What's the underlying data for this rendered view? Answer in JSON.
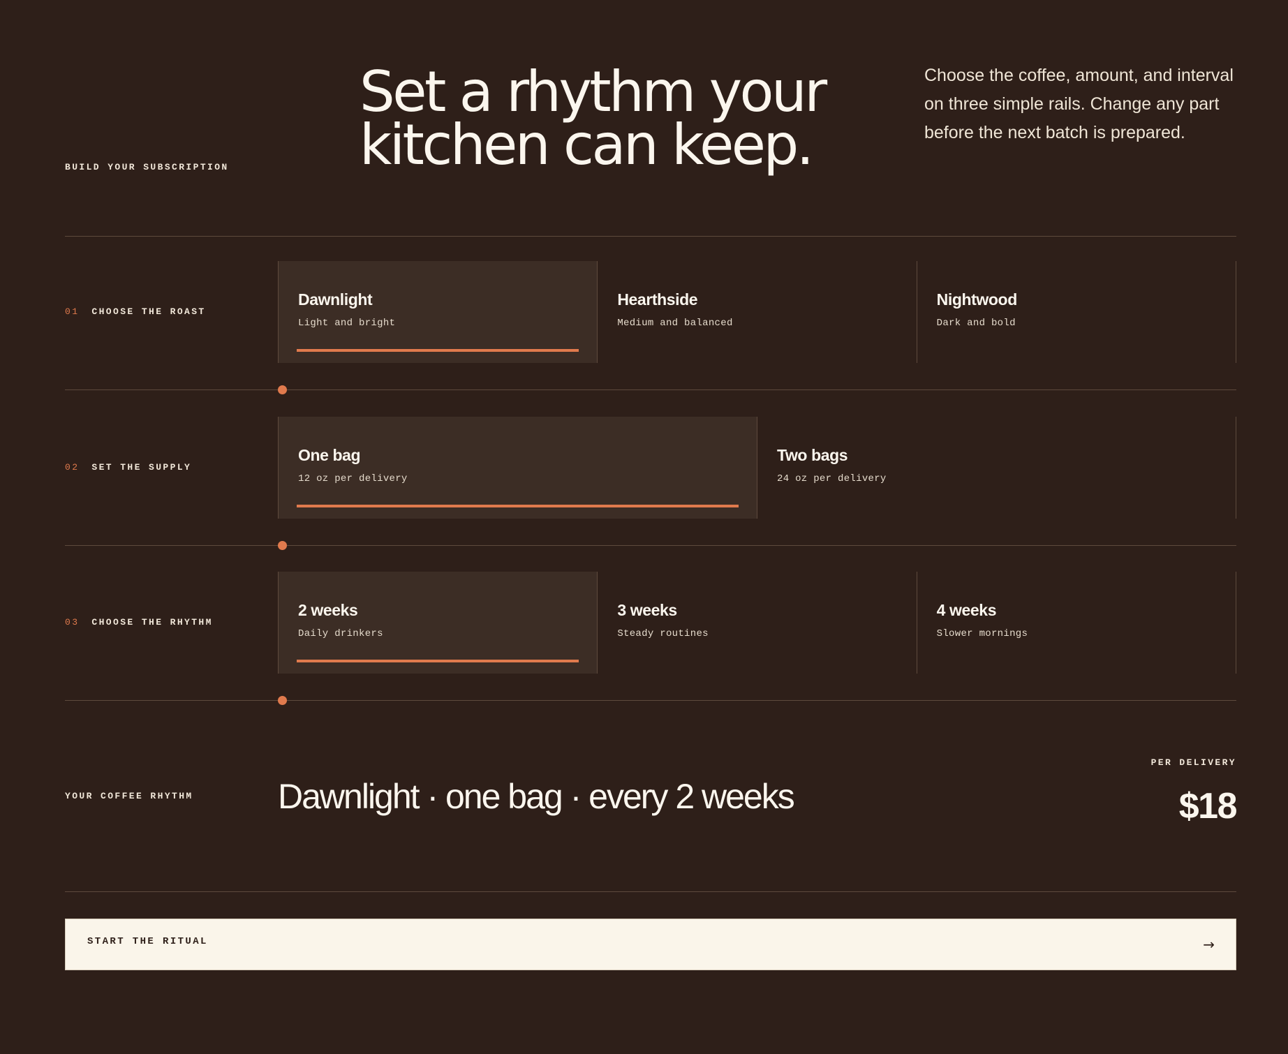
{
  "header": {
    "eyebrow": "BUILD YOUR SUBSCRIPTION",
    "headline_line1": "Set a rhythm your",
    "headline_line2": "kitchen can keep.",
    "intro": "Choose the coffee, amount, and interval on three simple rails. Change any part before the next batch is prepared."
  },
  "rows": [
    {
      "number": "01",
      "label": "CHOOSE THE ROAST",
      "options": [
        {
          "title": "Dawnlight",
          "subtitle": "Light and bright",
          "selected": true
        },
        {
          "title": "Hearthside",
          "subtitle": "Medium and balanced",
          "selected": false
        },
        {
          "title": "Nightwood",
          "subtitle": "Dark and bold",
          "selected": false
        }
      ]
    },
    {
      "number": "02",
      "label": "SET THE SUPPLY",
      "options": [
        {
          "title": "One bag",
          "subtitle": "12 oz per delivery",
          "selected": true
        },
        {
          "title": "Two bags",
          "subtitle": "24 oz per delivery",
          "selected": false
        }
      ]
    },
    {
      "number": "03",
      "label": "CHOOSE THE RHYTHM",
      "options": [
        {
          "title": "2 weeks",
          "subtitle": "Daily drinkers",
          "selected": true
        },
        {
          "title": "3 weeks",
          "subtitle": "Steady routines",
          "selected": false
        },
        {
          "title": "4 weeks",
          "subtitle": "Slower mornings",
          "selected": false
        }
      ]
    }
  ],
  "summary": {
    "label": "YOUR COFFEE RHYTHM",
    "text": "Dawnlight · one bag · every 2 weeks",
    "price_label": "PER DELIVERY",
    "price": "$18"
  },
  "cta": {
    "label": "START THE RITUAL",
    "arrow": "→"
  },
  "colors": {
    "background": "#2e1f19",
    "accent": "#e07a4d",
    "selected_card": "#3c2d25",
    "cta_background": "#faf5ea"
  }
}
